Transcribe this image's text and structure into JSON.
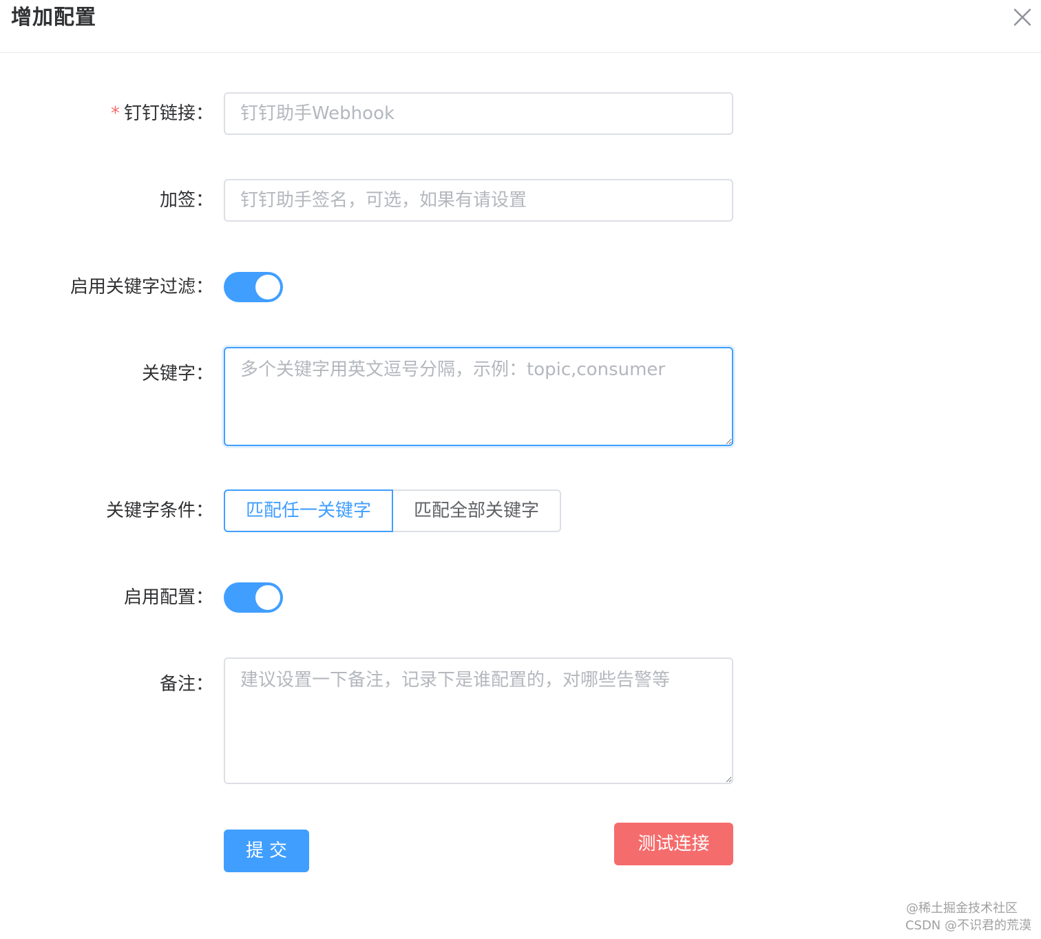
{
  "dialog": {
    "title": "增加配置"
  },
  "form": {
    "webhook": {
      "label": "钉钉链接：",
      "required_mark": "*",
      "placeholder": "钉钉助手Webhook",
      "value": ""
    },
    "sign": {
      "label": "加签：",
      "placeholder": "钉钉助手签名，可选，如果有请设置",
      "value": ""
    },
    "keyword_filter": {
      "label": "启用关键字过滤：",
      "enabled": true
    },
    "keywords": {
      "label": "关键字：",
      "placeholder": "多个关键字用英文逗号分隔，示例：topic,consumer",
      "value": ""
    },
    "keyword_condition": {
      "label": "关键字条件：",
      "options": [
        "匹配任一关键字",
        "匹配全部关键字"
      ],
      "selected": "匹配任一关键字"
    },
    "enable_config": {
      "label": "启用配置：",
      "enabled": true
    },
    "remark": {
      "label": "备注：",
      "placeholder": "建议设置一下备注，记录下是谁配置的，对哪些告警等",
      "value": ""
    }
  },
  "actions": {
    "submit_label": "提交",
    "test_label": "测试连接"
  },
  "watermark": {
    "line1": "@稀土掘金技术社区",
    "line2": "CSDN @不识君的荒漠"
  },
  "colors": {
    "primary": "#409eff",
    "danger": "#f56c6c",
    "required": "#f56c6c",
    "border": "#dcdfe6",
    "placeholder": "#b4b7bd",
    "label": "#303133"
  },
  "icons": {
    "close": "close-icon"
  }
}
